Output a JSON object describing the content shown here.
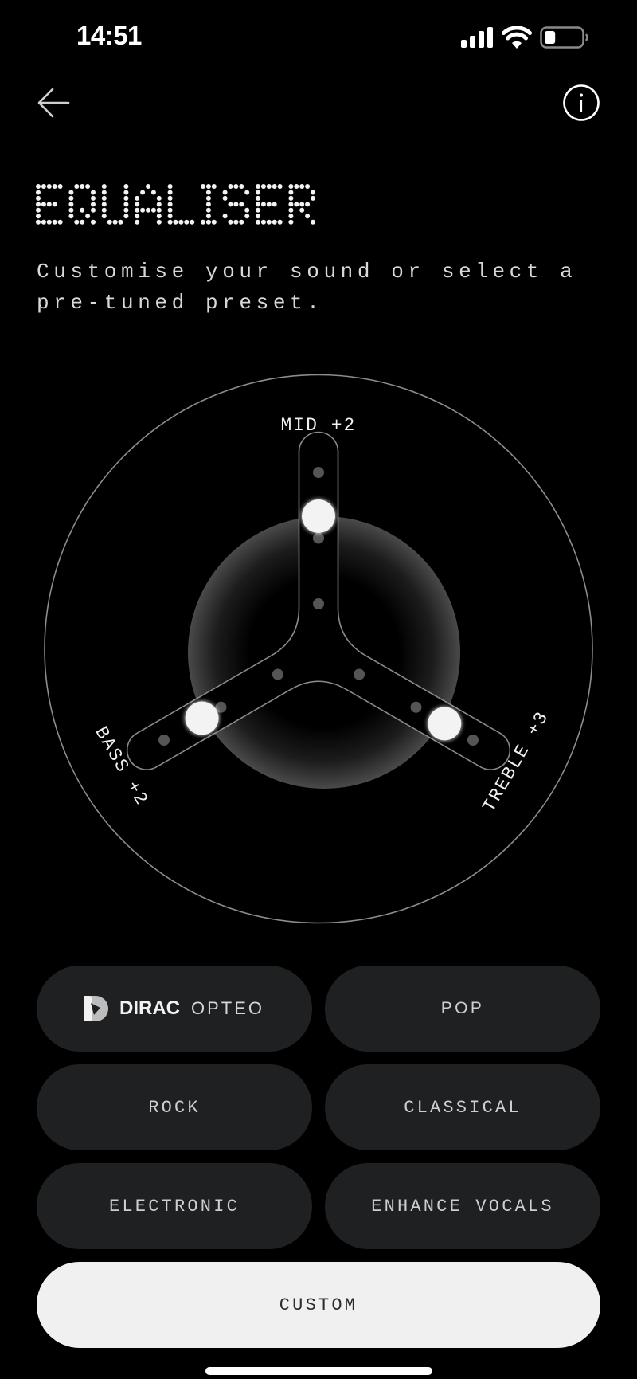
{
  "status_bar": {
    "time": "14:51",
    "signal_bars": 4,
    "wifi": "full",
    "battery_level": 0.3
  },
  "nav": {
    "back_icon": "arrow-left-icon",
    "info_icon": "info-circle-icon"
  },
  "header": {
    "title": "EQUALISER",
    "subtitle": "Customise your sound or select a pre-tuned preset."
  },
  "equaliser": {
    "range": [
      -6,
      6
    ],
    "bands": [
      {
        "id": "mid",
        "label": "MID",
        "value": 2,
        "display": "MID +2"
      },
      {
        "id": "treble",
        "label": "TREBLE",
        "value": 3,
        "display": "TREBLE +3"
      },
      {
        "id": "bass",
        "label": "BASS",
        "value": 2,
        "display": "BASS +2"
      }
    ]
  },
  "presets": {
    "items": [
      {
        "id": "dirac-opteo",
        "brand": "DIRAC",
        "label": "OPTEO",
        "selected": false
      },
      {
        "id": "pop",
        "label": "POP",
        "selected": false
      },
      {
        "id": "rock",
        "label": "ROCK",
        "selected": false
      },
      {
        "id": "classical",
        "label": "CLASSICAL",
        "selected": false
      },
      {
        "id": "electronic",
        "label": "ELECTRONIC",
        "selected": false
      },
      {
        "id": "enhance-vocals",
        "label": "ENHANCE VOCALS",
        "selected": false
      }
    ],
    "custom": {
      "id": "custom",
      "label": "CUSTOM",
      "selected": true
    }
  },
  "colors": {
    "background": "#000000",
    "button_bg": "#1f2022",
    "selected_bg": "#eff0ef",
    "knob": "#f2f3f2",
    "track_dot": "#555555",
    "outline": "#8a8a8a"
  }
}
